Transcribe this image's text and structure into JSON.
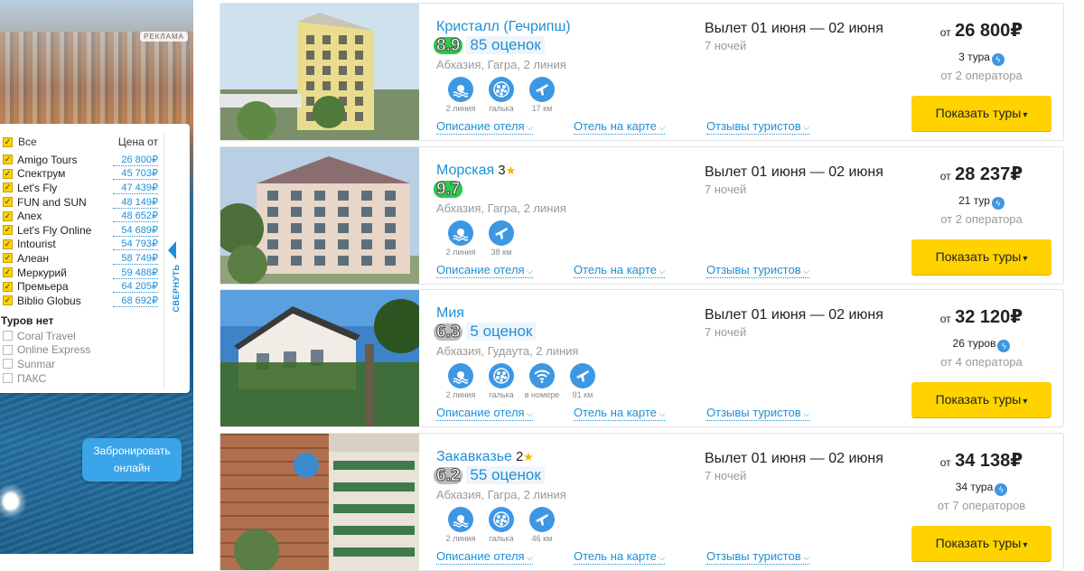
{
  "ad": {
    "label": "РЕКЛАМА",
    "filter": {
      "all_label": "Все",
      "price_from_label": "Цена от",
      "operators": [
        {
          "name": "Amigo Tours",
          "price": "26 800₽"
        },
        {
          "name": "Спектрум",
          "price": "45 703₽"
        },
        {
          "name": "Let's Fly",
          "price": "47 439₽"
        },
        {
          "name": "FUN and SUN",
          "price": "48 149₽"
        },
        {
          "name": "Anex",
          "price": "48 652₽"
        },
        {
          "name": "Let's Fly Online",
          "price": "54 689₽"
        },
        {
          "name": "Intourist",
          "price": "54 793₽"
        },
        {
          "name": "Алеан",
          "price": "58 749₽"
        },
        {
          "name": "Меркурий",
          "price": "59 488₽"
        },
        {
          "name": "Премьера",
          "price": "64 205₽"
        },
        {
          "name": "Biblio Globus",
          "price": "68 692₽"
        }
      ],
      "no_tours_label": "Туров нет",
      "no_tours": [
        "Coral Travel",
        "Online Express",
        "Sunmar",
        "ПАКС"
      ],
      "collapse_label": "СВЕРНУТЬ"
    },
    "book_button": "Забронировать онлайн"
  },
  "links": {
    "description": "Описание отеля",
    "map": "Отель на карте",
    "reviews": "Отзывы туристов"
  },
  "button_label": "Показать туры",
  "hotels": [
    {
      "name": "Кристалл (Гечрипш)",
      "stars": "",
      "rating": "8.9",
      "reviews": "85 оценок",
      "location": "Абхазия, Гагра, 2 линия",
      "amenities": [
        {
          "icon": "beach-line-icon",
          "label": "2 линия"
        },
        {
          "icon": "pebble-icon",
          "label": "галька"
        },
        {
          "icon": "airport-icon",
          "label": "17 км"
        }
      ],
      "dates": "Вылет 01 июня — 02 июня",
      "nights": "7 ночей",
      "price_from": "от",
      "price": "26 800₽",
      "tours": "3 тура",
      "operators": "от 2 оператора"
    },
    {
      "name": "Морская",
      "stars": "3",
      "rating": "9.7",
      "reviews": "",
      "location": "Абхазия, Гагра, 2 линия",
      "amenities": [
        {
          "icon": "beach-line-icon",
          "label": "2 линия"
        },
        {
          "icon": "airport-icon",
          "label": "38 км"
        }
      ],
      "dates": "Вылет 01 июня — 02 июня",
      "nights": "7 ночей",
      "price_from": "от",
      "price": "28 237₽",
      "tours": "21 тур",
      "operators": "от 2 оператора"
    },
    {
      "name": "Мия",
      "stars": "",
      "rating": "6.3",
      "reviews": "5 оценок",
      "location": "Абхазия, Гудаута, 2 линия",
      "amenities": [
        {
          "icon": "beach-line-icon",
          "label": "2 линия"
        },
        {
          "icon": "pebble-icon",
          "label": "галька"
        },
        {
          "icon": "wifi-icon",
          "label": "в номере"
        },
        {
          "icon": "airport-icon",
          "label": "91 км"
        }
      ],
      "dates": "Вылет 01 июня — 02 июня",
      "nights": "7 ночей",
      "price_from": "от",
      "price": "32 120₽",
      "tours": "26 туров",
      "operators": "от 4 оператора"
    },
    {
      "name": "Закавказье",
      "stars": "2",
      "rating": "6.2",
      "reviews": "55 оценок",
      "location": "Абхазия, Гагра, 2 линия",
      "amenities": [
        {
          "icon": "beach-line-icon",
          "label": "2 линия"
        },
        {
          "icon": "pebble-icon",
          "label": "галька"
        },
        {
          "icon": "airport-icon",
          "label": "46 км"
        }
      ],
      "dates": "Вылет 01 июня — 02 июня",
      "nights": "7 ночей",
      "price_from": "от",
      "price": "34 138₽",
      "tours": "34 тура",
      "operators": "от 7 операторов"
    }
  ]
}
